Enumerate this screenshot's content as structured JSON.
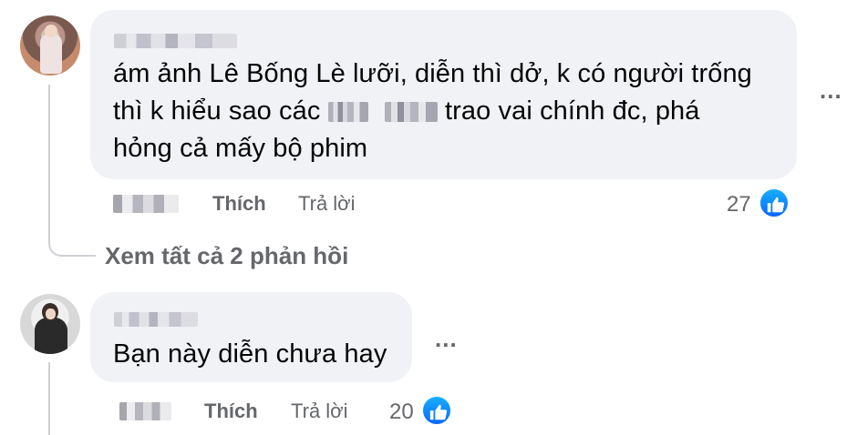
{
  "comments": [
    {
      "author_name": "",
      "text_part1": "ám ảnh Lê Bống Lè lưỡi, diễn thì dở, k có người trống",
      "text_part2_before": "thì k hiểu sao các",
      "text_part2_after": "trao vai chính đc, phá",
      "text_part3": "hỏng cả mấy bộ phim",
      "like_label": "Thích",
      "reply_label": "Trả lời",
      "reaction_count": "27",
      "more_label": "...",
      "view_replies_label": "Xem tất cả 2 phản hồi"
    },
    {
      "author_name": "",
      "text": "Bạn này diễn chưa hay",
      "like_label": "Thích",
      "reply_label": "Trả lời",
      "reaction_count": "20",
      "more_label": "..."
    }
  ],
  "colors": {
    "bubble_bg": "#f0f2f5",
    "secondary_text": "#65676b",
    "like_blue": "#0866ff"
  },
  "icons": {
    "like": "thumbs-up-icon",
    "more": "more-options-icon"
  }
}
